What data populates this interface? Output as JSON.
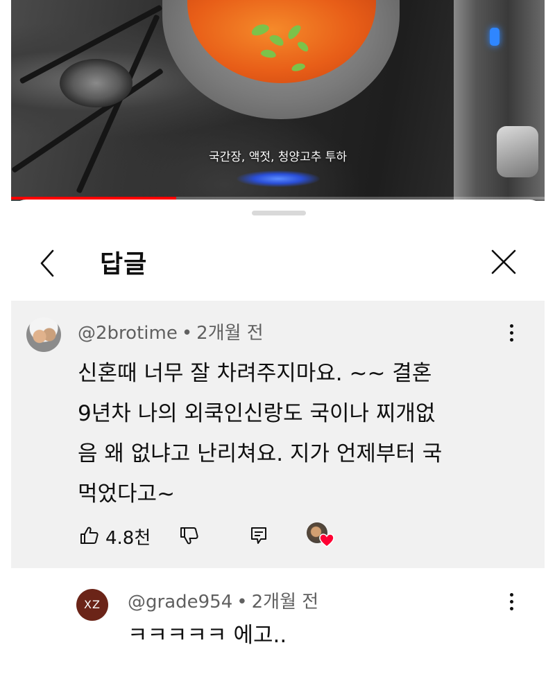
{
  "video": {
    "subtitle": "국간장, 액젓, 청양고추 투하",
    "progress": 0.31,
    "accent_color": "#ff0000"
  },
  "sheet": {
    "title": "답글",
    "back_icon": "chevron-left-icon",
    "close_icon": "close-icon"
  },
  "comment": {
    "author": "@2brotime",
    "separator": "•",
    "time": "2개월 전",
    "lines": [
      "신혼때 너무  잘 차려주지마요. ~~  결혼",
      "9년차 나의 외쿡인신랑도  국이나 찌개없",
      "음 왜 없냐고 난리쳐요. 지가 언제부터 국",
      "먹었다고~"
    ],
    "likes": "4.8천",
    "icons": {
      "like": "thumbs-up-icon",
      "dislike": "thumbs-down-icon",
      "reply": "reply-icon",
      "creator_heart": "creator-heart-icon",
      "more": "more-vert-icon"
    },
    "background": "#f1f1f1"
  },
  "reply": {
    "avatar_initials": "XZ",
    "avatar_color": "#6b2418",
    "author": "@grade954",
    "separator": "•",
    "time": "2개월 전",
    "text": "ㅋㅋㅋㅋㅋ 에고.."
  }
}
